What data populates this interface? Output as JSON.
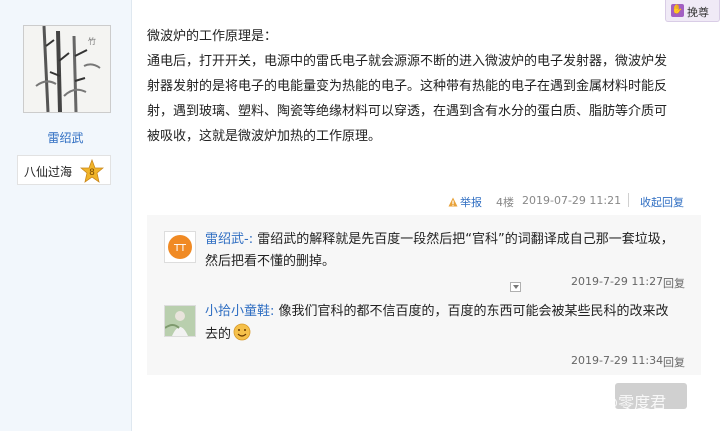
{
  "sidebar": {
    "username": "雷绍武",
    "rank_title": "八仙过海",
    "rank_level": "8"
  },
  "topbar": {
    "tab_label": "挽尊"
  },
  "post": {
    "lines": [
      "微波炉的工作原理是：",
      "通电后，打开开关，电源中的雷氏电子就会源源不断的进入微波炉的电子发射器，微波炉发",
      "射器发射的是将电子的电能量变为热能的电子。这种带有热能的电子在遇到金属材料时能反",
      "射，遇到玻璃、塑料、陶瓷等绝缘材料可以穿透，在遇到含有水分的蛋白质、脂肪等介质可",
      "被吸收，这就是微波炉加热的工作原理。"
    ],
    "report_label": "举报",
    "floor": "4楼",
    "time": "2019-07-29 11:21",
    "collapse_label": "收起回复"
  },
  "comments": [
    {
      "user": "雷绍武-:",
      "text_line1": "雷绍武的解释就是先百度一段然后把“官科”的词翻译成自己那一套垃圾，",
      "text_line2": "然后把看不懂的删掉。",
      "time": "2019-7-29 11:27",
      "reply_label": "回复",
      "avatar_text": "TT"
    },
    {
      "user": "小拾小童鞋:",
      "text_line1": "像我们官科的都不信百度的，百度的东西可能会被某些民科的改来改",
      "text_line2": "去的",
      "time": "2019-7-29 11:34",
      "reply_label": "回复"
    }
  ],
  "watermark": "知乎 @零度君",
  "colors": {
    "link": "#2f6ec2",
    "sidebar_bg": "#f2f7fc",
    "comment_bg": "#f7f7f7",
    "badge": "#f0b429"
  }
}
